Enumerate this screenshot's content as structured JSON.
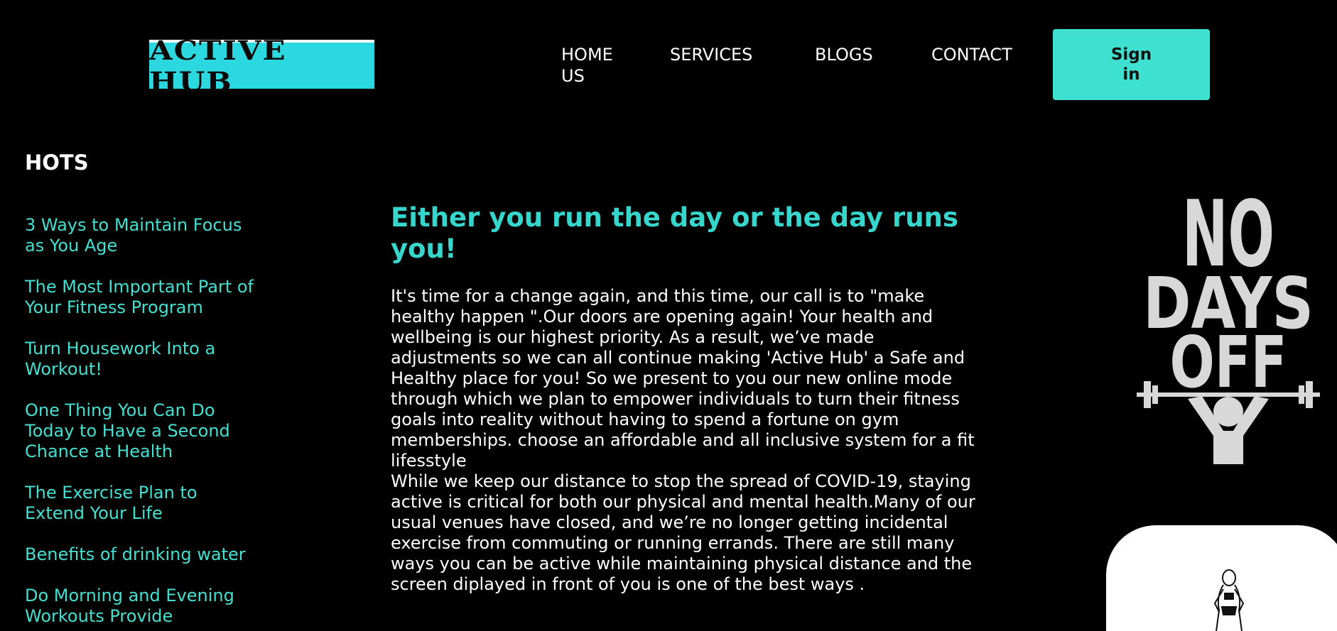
{
  "header": {
    "logo_text": "ACTIVE HUB",
    "nav": [
      {
        "label": "HOME US"
      },
      {
        "label": "SERVICES"
      },
      {
        "label": "BLOGS"
      },
      {
        "label": "CONTACT"
      }
    ],
    "signin_label": "Sign in"
  },
  "sidebar": {
    "title": "HOTS",
    "items": [
      {
        "label": "3 Ways to Maintain Focus as You Age"
      },
      {
        "label": "The Most Important Part of Your Fitness Program"
      },
      {
        "label": "Turn Housework Into a Workout!"
      },
      {
        "label": "One Thing You Can Do Today to Have a Second Chance at Health"
      },
      {
        "label": "The Exercise Plan to Extend Your Life"
      },
      {
        "label": "Benefits of drinking water"
      },
      {
        "label": "Do Morning and Evening Workouts Provide"
      }
    ]
  },
  "main": {
    "headline": "Either you run the day or the day runs you!",
    "paragraph1": "It's time for a change again, and this time, our call is to \"make healthy happen \".Our doors are opening again! Your health and wellbeing is our highest priority. As a result, we’ve made adjustments so we can all continue making 'Active Hub' a Safe and Healthy place for you! So we present to you our new online mode through which we plan to empower individuals to turn their fitness goals into reality without having to spend a fortune on gym memberships. choose an affordable and all inclusive system for a fit lifesstyle",
    "paragraph2": "While we keep our distance to stop the spread of COVID-19, staying active is critical for both our physical and mental health.Many of our usual venues have closed, and we’re no longer getting incidental exercise from commuting or running errands. There are still many ways you can be active while maintaining physical distance and the screen diplayed in front of you is one of the best ways ."
  },
  "poster": {
    "line1": "NO",
    "line2": "DAYS",
    "line3": "OFF"
  },
  "colors": {
    "accent": "#3fe0d0",
    "logo_bg": "#2bd8df",
    "link": "#43e0cf",
    "headline": "#37d6cc",
    "background": "#000000"
  }
}
